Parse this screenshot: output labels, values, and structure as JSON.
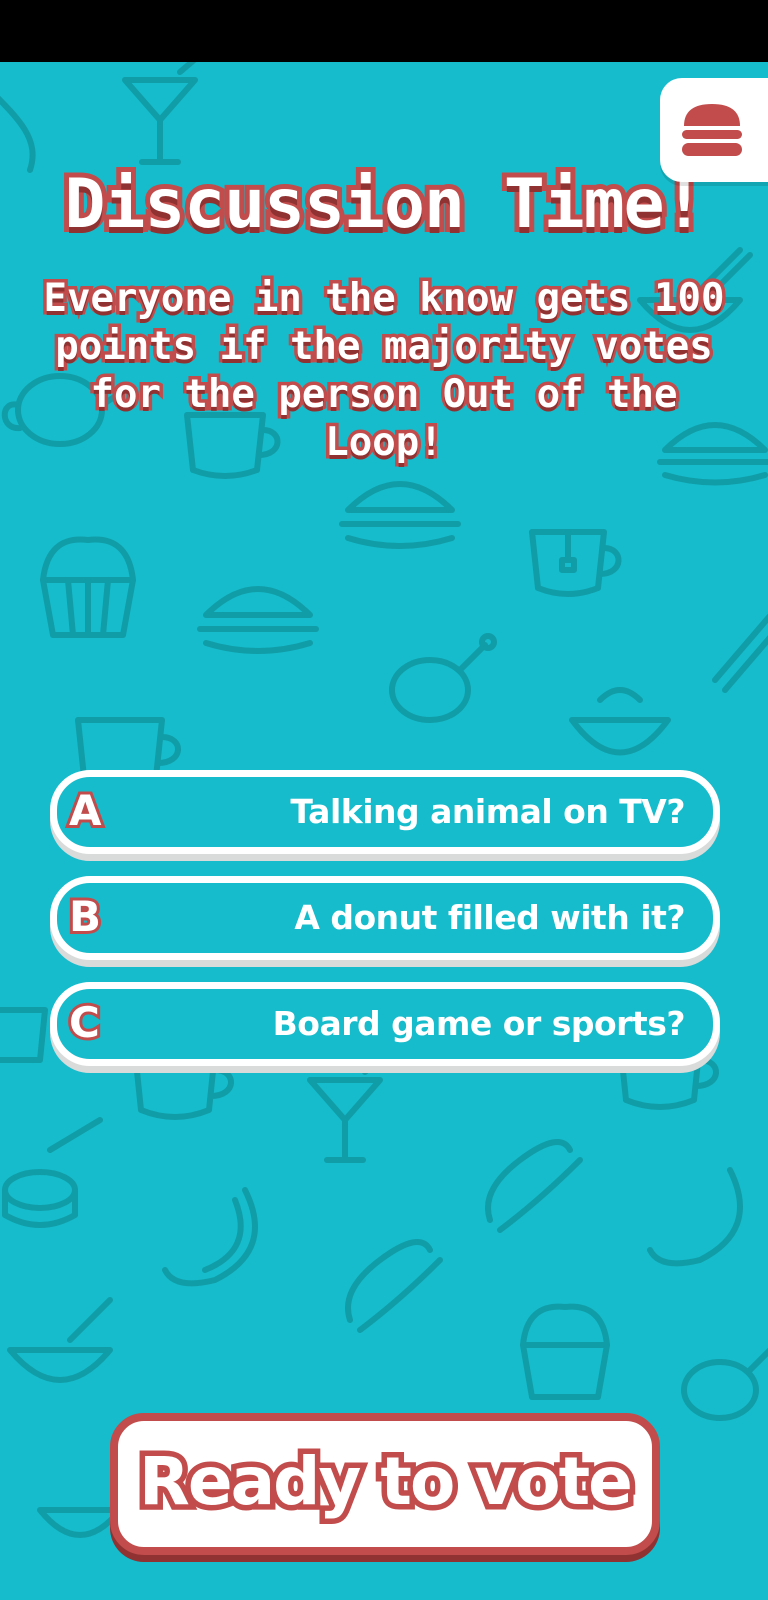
{
  "screen": {
    "title": "Discussion Time!",
    "subtitle": "Everyone in the know gets 100 points if the majority votes for the person Out of the Loop!"
  },
  "menu": {
    "icon": "burger-menu-icon"
  },
  "answers": [
    {
      "letter": "A",
      "text": "Talking animal on TV?"
    },
    {
      "letter": "B",
      "text": "A donut filled with it?"
    },
    {
      "letter": "C",
      "text": "Board game or sports?"
    }
  ],
  "vote_button": {
    "label": "Ready to vote"
  },
  "colors": {
    "background": "#16bccb",
    "pattern": "#0f8f99",
    "accent_red": "#c14c4b",
    "white": "#ffffff"
  }
}
